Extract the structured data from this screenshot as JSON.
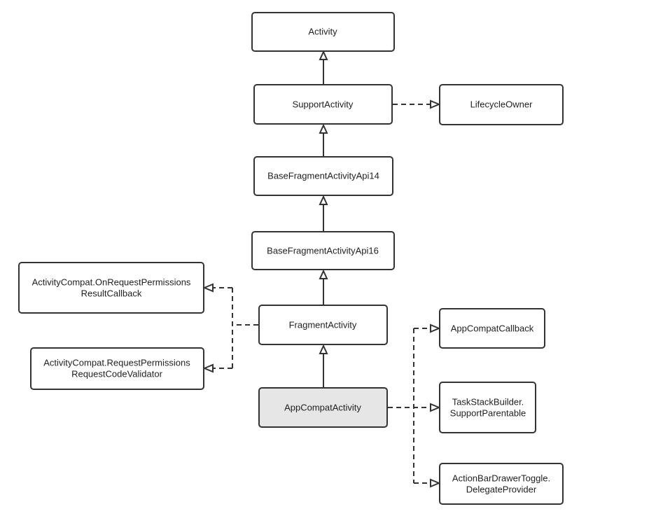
{
  "nodes": {
    "activity": "Activity",
    "support_activity": "SupportActivity",
    "lifecycle_owner": "LifecycleOwner",
    "base_api14": "BaseFragmentActivityApi14",
    "base_api16": "BaseFragmentActivityApi16",
    "on_request_permissions": [
      "ActivityCompat.OnRequestPermissions",
      "ResultCallback"
    ],
    "request_code_validator": [
      "ActivityCompat.RequestPermissions",
      "RequestCodeValidator"
    ],
    "fragment_activity": "FragmentActivity",
    "appcompat_activity": "AppCompatActivity",
    "appcompat_callback": "AppCompatCallback",
    "task_stack_builder": [
      "TaskStackBuilder.",
      "SupportParentable"
    ],
    "action_bar_drawer_toggle": [
      "ActionBarDrawerToggle.",
      "DelegateProvider"
    ]
  },
  "edges": [
    {
      "from": "support_activity",
      "to": "activity",
      "type": "inheritance"
    },
    {
      "from": "support_activity",
      "to": "lifecycle_owner",
      "type": "realization"
    },
    {
      "from": "base_api14",
      "to": "support_activity",
      "type": "inheritance"
    },
    {
      "from": "base_api16",
      "to": "base_api14",
      "type": "inheritance"
    },
    {
      "from": "fragment_activity",
      "to": "base_api16",
      "type": "inheritance"
    },
    {
      "from": "fragment_activity",
      "to": "on_request_permissions",
      "type": "realization"
    },
    {
      "from": "fragment_activity",
      "to": "request_code_validator",
      "type": "realization"
    },
    {
      "from": "appcompat_activity",
      "to": "fragment_activity",
      "type": "inheritance"
    },
    {
      "from": "appcompat_activity",
      "to": "appcompat_callback",
      "type": "realization"
    },
    {
      "from": "appcompat_activity",
      "to": "task_stack_builder",
      "type": "realization"
    },
    {
      "from": "appcompat_activity",
      "to": "action_bar_drawer_toggle",
      "type": "realization"
    }
  ],
  "colors": {
    "highlight_fill": "#e6e6e6",
    "stroke": "#333333"
  }
}
